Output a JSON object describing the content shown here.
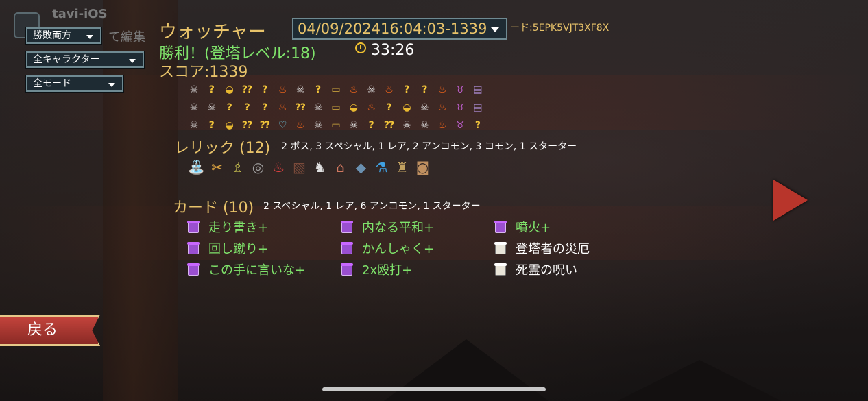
{
  "filters": {
    "outcome": "勝敗両方",
    "character": "全キャラクター",
    "mode": "全モード"
  },
  "player": {
    "name": "tavi-iOS",
    "edit_label": "て編集"
  },
  "header": {
    "character": "ウォッチャー",
    "run_selector": "04/09/202416:04:03-1339",
    "seed_text": "ード:5EPK5VJT3XF8X",
    "result": "勝利！(登塔レベル:18)",
    "time": "33:26",
    "score": "スコア:1339"
  },
  "path": [
    [
      "monster",
      "event",
      "shop",
      "event-monster",
      "event",
      "elite",
      "monster",
      "event",
      "treasure",
      "elite",
      "monster",
      "elite",
      "event",
      "event",
      "elite",
      "boss",
      "chest"
    ],
    [
      "monster",
      "monster",
      "event",
      "event",
      "event",
      "elite",
      "event-monster",
      "monster",
      "treasure",
      "shop",
      "elite",
      "event",
      "shop",
      "monster",
      "elite",
      "boss",
      "chest"
    ],
    [
      "monster",
      "event",
      "shop",
      "event-monster",
      "event-shop",
      "rest",
      "elite",
      "monster",
      "treasure",
      "monster",
      "event",
      "event-shop",
      "monster",
      "monster",
      "elite",
      "boss",
      "event"
    ]
  ],
  "path_icons": {
    "monster": "☠",
    "event": "?",
    "shop": "◒",
    "event-monster": "⁇",
    "event-shop": "⁇",
    "elite": "♨",
    "treasure": "▭",
    "boss": "♉",
    "chest": "▤",
    "rest": "♡"
  },
  "relics": {
    "title": "レリック (12)",
    "summary": "2 ボス, 3 スペシャル, 1 レア, 2 アンコモン, 3 コモン, 1 スターター",
    "items": [
      {
        "icon": "fountain-icon",
        "glyph": "⛲"
      },
      {
        "icon": "claw-icon",
        "glyph": "✂"
      },
      {
        "icon": "idol-icon",
        "glyph": "♗"
      },
      {
        "icon": "orb-ring-icon",
        "glyph": "◎"
      },
      {
        "icon": "flame-spirit-icon",
        "glyph": "♨"
      },
      {
        "icon": "book-icon",
        "glyph": "▧"
      },
      {
        "icon": "beast-icon",
        "glyph": "♞"
      },
      {
        "icon": "house-icon",
        "glyph": "⌂"
      },
      {
        "icon": "fish-icon",
        "glyph": "◆"
      },
      {
        "icon": "potion-icon",
        "glyph": "⚗"
      },
      {
        "icon": "lantern-icon",
        "glyph": "♜"
      },
      {
        "icon": "bag-icon",
        "glyph": "◙"
      }
    ]
  },
  "cards": {
    "title": "カード (10)",
    "summary": "2 スペシャル, 1 レア, 6 アンコモン, 1 スターター",
    "items": [
      {
        "label": "走り書き+",
        "color": "green",
        "icon": "purple"
      },
      {
        "label": "回し蹴り+",
        "color": "green",
        "icon": "purple"
      },
      {
        "label": "この手に言いな+",
        "color": "green",
        "icon": "purple"
      },
      {
        "label": "内なる平和+",
        "color": "green",
        "icon": "purple"
      },
      {
        "label": "かんしゃく+",
        "color": "green",
        "icon": "purple"
      },
      {
        "label": "2x殴打+",
        "color": "green",
        "icon": "purple"
      },
      {
        "label": "噴火+",
        "color": "green",
        "icon": "purple"
      },
      {
        "label": "登塔者の災厄",
        "color": "white",
        "icon": "white"
      },
      {
        "label": "死霊の呪い",
        "color": "white",
        "icon": "white"
      }
    ]
  },
  "nav": {
    "back_label": "戻る"
  },
  "colors": {
    "accent": "#e8c36a",
    "positive": "#7fe36b",
    "back": "#b8352b"
  }
}
